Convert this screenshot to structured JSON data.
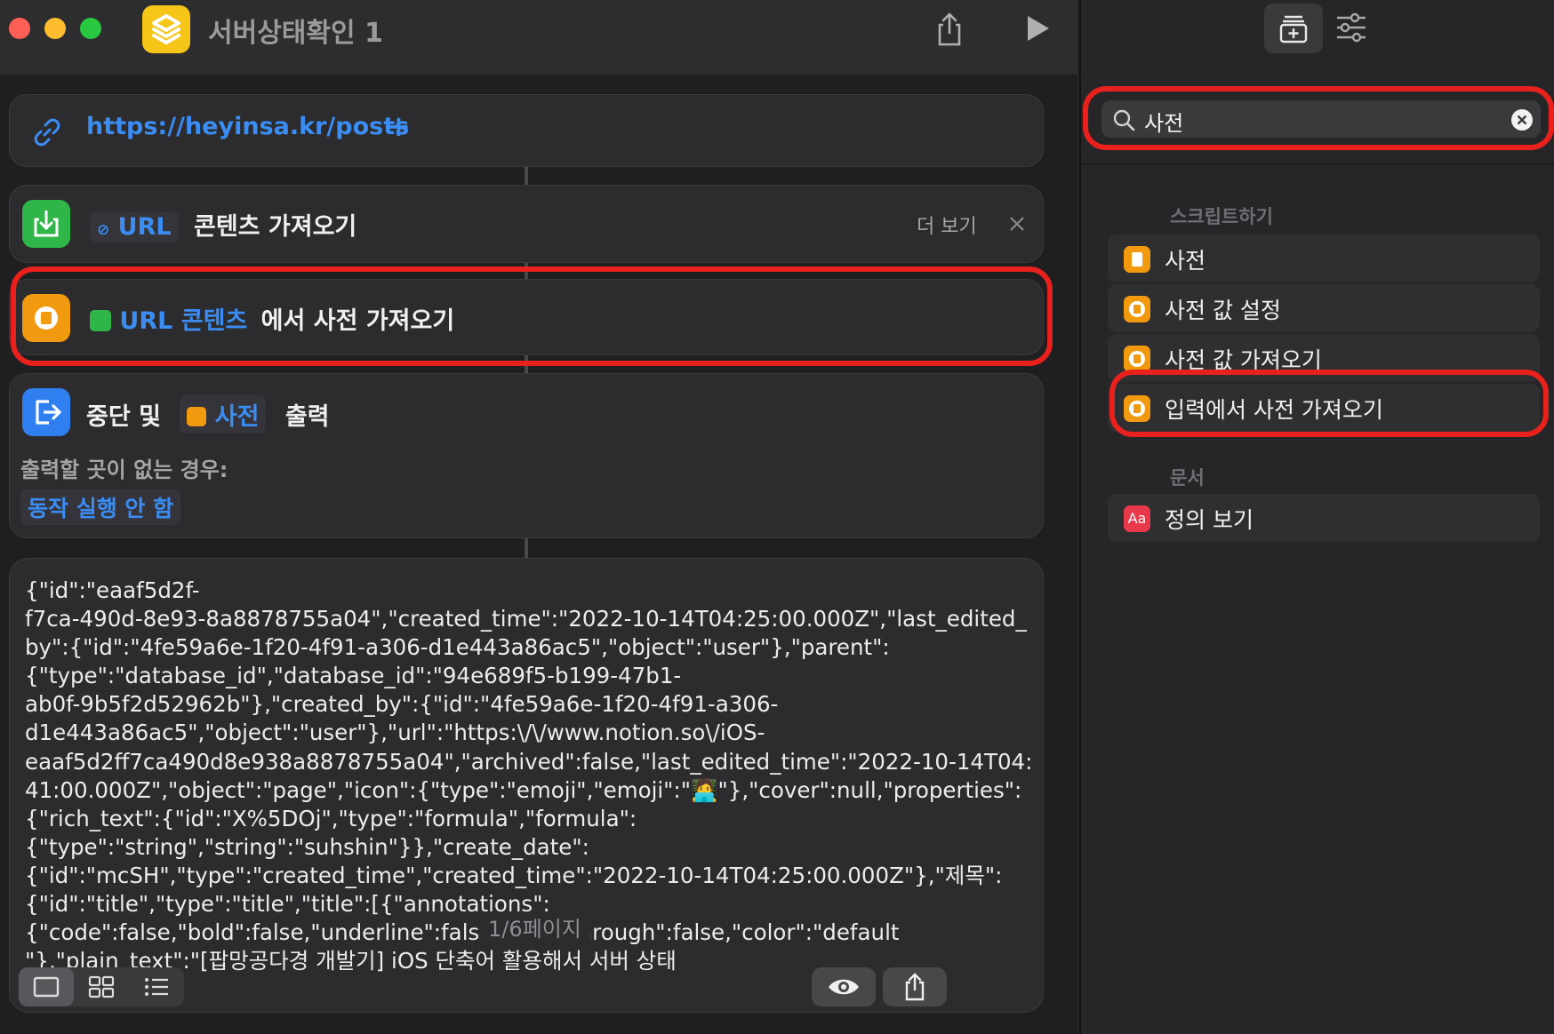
{
  "window": {
    "title": "서버상태확인 1"
  },
  "colors": {
    "accent": "#3b8df3",
    "highlight": "#e8211d",
    "orange": "#f29a0f",
    "green": "#2fb648",
    "blue": "#2f7ff0"
  },
  "actions": {
    "url": {
      "value": "https://heyinsa.kr/posts",
      "add_glyph": "+"
    },
    "get_contents": {
      "token": "URL",
      "label": "콘텐츠 가져오기",
      "more": "더 보기"
    },
    "get_dictionary": {
      "token": "URL 콘텐츠",
      "label": "에서 사전 가져오기"
    },
    "stop_output": {
      "prefix": "중단 및",
      "token": "사전",
      "suffix": "출력",
      "fallback_label": "출력할 곳이 없는 경우:",
      "fallback_value": "동작 실행 안 함"
    }
  },
  "result": {
    "text": "{\"id\":\"eaaf5d2f-\nf7ca-490d-8e93-8a8878755a04\",\"created_time\":\"2022-10-14T04:25:00.000Z\",\"last_edited_by\":{\"id\":\"4fe59a6e-1f20-4f91-a306-d1e443a86ac5\",\"object\":\"user\"},\"parent\":\n{\"type\":\"database_id\",\"database_id\":\"94e689f5-b199-47b1-\nab0f-9b5f2d52962b\"},\"created_by\":{\"id\":\"4fe59a6e-1f20-4f91-a306-\nd1e443a86ac5\",\"object\":\"user\"},\"url\":\"https:\\/\\/www.notion.so\\/iOS-\neaaf5d2ff7ca490d8e938a8878755a04\",\"archived\":false,\"last_edited_time\":\"2022-10-14T04:41:00.000Z\",\"object\":\"page\",\"icon\":{\"type\":\"emoji\",\"emoji\":\"🧑‍💻\"},\"cover\":null,\"properties\":\n{\"rich_text\":{\"id\":\"X%5DOj\",\"type\":\"formula\",\"formula\":\n{\"type\":\"string\",\"string\":\"suhshin\"}},\"create_date\":\n{\"id\":\"mcSH\",\"type\":\"created_time\",\"created_time\":\"2022-10-14T04:25:00.000Z\"},\"제목\":\n{\"id\":\"title\",\"type\":\"title\",\"title\":[{\"annotations\":\n{\"code\":false,\"bold\":false,\"underline\":false,\"strikethrough\":false,\"color\":\"default\n\"},\"plain_text\":\"[팝망공다경 개발기] iOS 단축어 활용해서 서버 상태",
    "page": "1/6페이지"
  },
  "sidebar": {
    "search_value": "사전",
    "section_scripting": "스크립트하기",
    "items": [
      {
        "label": "사전",
        "icon": "dictionary-icon"
      },
      {
        "label": "사전 값 설정",
        "icon": "dictionary-icon"
      },
      {
        "label": "사전 값 가져오기",
        "icon": "dictionary-icon"
      },
      {
        "label": "입력에서 사전 가져오기",
        "icon": "dictionary-icon"
      }
    ],
    "section_documents": "문서",
    "doc_items": [
      {
        "label": "정의 보기",
        "icon": "dictionary-app-icon",
        "icon_text": "Aa"
      }
    ]
  }
}
